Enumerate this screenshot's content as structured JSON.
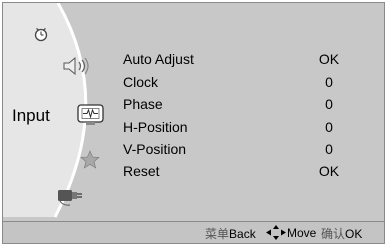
{
  "sidebar": {
    "active_label": "Input",
    "icons": [
      "clock-icon",
      "speaker-icon",
      "input-monitor-icon",
      "star-icon",
      "plug-icon"
    ]
  },
  "menu": {
    "items": [
      {
        "label": "Auto Adjust",
        "value": "OK"
      },
      {
        "label": "Clock",
        "value": "0"
      },
      {
        "label": "Phase",
        "value": "0"
      },
      {
        "label": "H-Position",
        "value": "0"
      },
      {
        "label": "V-Position",
        "value": "0"
      },
      {
        "label": "Reset",
        "value": "OK"
      }
    ]
  },
  "footer": {
    "back_cn": "菜单",
    "back_en": "Back",
    "move_en": "Move",
    "ok_cn": "确认",
    "ok_en": "OK"
  }
}
